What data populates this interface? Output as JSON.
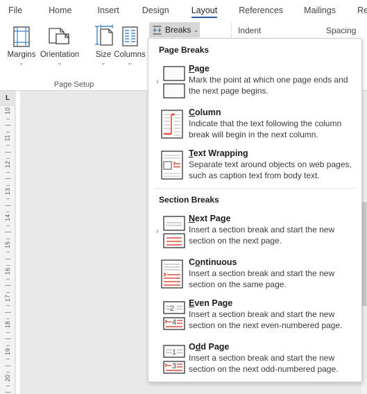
{
  "app": {
    "name": "Microsoft Word",
    "accent_color": "#2b579a",
    "red_color": "#d94f3d",
    "menu_bg": "#ffffff",
    "doc_bg": "#e9e9e9"
  },
  "ribbon": {
    "tabs": [
      {
        "label": "File",
        "active": false
      },
      {
        "label": "Home",
        "active": false
      },
      {
        "label": "Insert",
        "active": false
      },
      {
        "label": "Design",
        "active": false
      },
      {
        "label": "Layout",
        "active": true
      },
      {
        "label": "References",
        "active": false
      },
      {
        "label": "Mailings",
        "active": false
      },
      {
        "label": "Review",
        "active": false
      }
    ],
    "page_setup": {
      "group_label": "Page Setup",
      "buttons": [
        {
          "label": "Margins",
          "icon": "margins-icon",
          "caret": "⌄"
        },
        {
          "label": "Orientation",
          "icon": "orientation-icon",
          "caret": "⌄"
        },
        {
          "label": "Size",
          "icon": "size-icon",
          "caret": "⌄"
        },
        {
          "label": "Columns",
          "icon": "columns-icon",
          "caret": "⌄"
        }
      ]
    },
    "breaks_button": {
      "label": "Breaks",
      "caret": "⌄",
      "icon": "breaks-icon",
      "pressed": true
    },
    "indent_label": "Indent",
    "spacing_label": "Spacing"
  },
  "ruler": {
    "tab_selector_glyph": "L",
    "numbers": [
      "10",
      "11",
      "12",
      "13",
      "14",
      "15",
      "16",
      "17",
      "18",
      "19",
      "20"
    ]
  },
  "menu": {
    "sections": [
      {
        "header": "Page Breaks",
        "items": [
          {
            "title": "Page",
            "accel": "P",
            "desc": "Mark the point at which one page ends and the next page begins.",
            "icon": "page-break-icon",
            "selected": true
          },
          {
            "title": "Column",
            "accel": "C",
            "desc": "Indicate that the text following the column break will begin in the next column.",
            "icon": "column-break-icon",
            "selected": false
          },
          {
            "title": "Text Wrapping",
            "accel": "T",
            "desc": "Separate text around objects on web pages, such as caption text from body text.",
            "icon": "text-wrapping-break-icon",
            "selected": false
          }
        ]
      },
      {
        "header": "Section Breaks",
        "items": [
          {
            "title": "Next Page",
            "accel": "N",
            "desc": "Insert a section break and start the new section on the next page.",
            "icon": "next-page-break-icon",
            "selected": true
          },
          {
            "title": "Continuous",
            "accel": "o",
            "desc": "Insert a section break and start the new section on the same page.",
            "icon": "continuous-break-icon",
            "selected": false
          },
          {
            "title": "Even Page",
            "accel": "E",
            "desc": "Insert a section break and start the new section on the next even-numbered page.",
            "icon": "even-page-break-icon",
            "top_number": "2",
            "bottom_number": "4",
            "selected": false
          },
          {
            "title": "Odd Page",
            "accel": "d",
            "desc": "Insert a section break and start the new section on the next odd-numbered page.",
            "icon": "odd-page-break-icon",
            "top_number": "1",
            "bottom_number": "3",
            "selected": false
          }
        ]
      }
    ]
  }
}
